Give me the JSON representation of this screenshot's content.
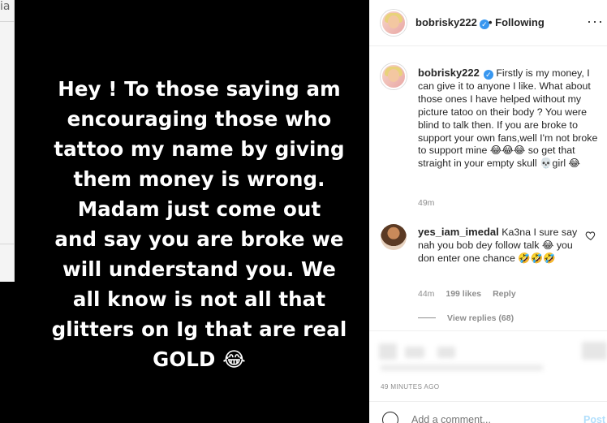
{
  "background_page": {
    "fragment": "ia"
  },
  "story": {
    "text_lines": [
      "Hey ! To those saying am",
      "encouraging those who",
      "tattoo my name by giving",
      "them money is wrong.",
      "Madam just come out",
      "and say you are broke we",
      "will understand you. We",
      "all know is not all that",
      "glitters on Ig that are real",
      "GOLD 😂"
    ]
  },
  "header": {
    "username": "bobrisky222",
    "verified_glyph": "✓",
    "follow_label": "• Following",
    "more_icon": "more-options-icon",
    "more_glyph": "···"
  },
  "caption": {
    "username": "bobrisky222",
    "verified_glyph": "✓",
    "text": "Firstly is my money, I can give it to anyone I like. What about those ones I have helped without my picture tatoo on their body ? You were blind to talk then. If you are broke to support your own fans,well I'm not broke to support mine 😂😂😂 so get that straight in your empty skull 💀girl 😂",
    "time": "49m"
  },
  "comment": {
    "username": "yes_iam_imedal",
    "text": "Ka3na I sure say nah you bob dey follow talk 😂 you don enter one chance 🤣🤣🤣",
    "time": "44m",
    "likes": "199 likes",
    "reply_label": "Reply",
    "view_replies": "View replies (68)"
  },
  "footer": {
    "posted_ago": "49 MINUTES AGO",
    "add_comment_placeholder": "Add a comment...",
    "post_label": "Post"
  },
  "colors": {
    "accent_blue": "#3897f0",
    "post_disabled": "#b2dffc",
    "story_bg": "#000000",
    "muted_text": "#8e8e8e"
  }
}
